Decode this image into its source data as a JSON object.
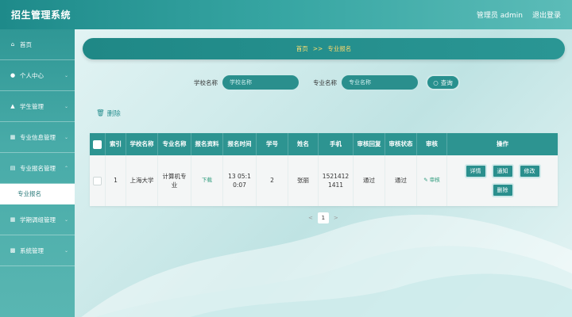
{
  "app": {
    "title": "招生管理系统"
  },
  "topbar": {
    "user": "管理员 admin",
    "logout": "退出登录"
  },
  "sidebar": {
    "items": [
      {
        "label": "首页",
        "icon": "home-icon",
        "glyph": "⌂"
      },
      {
        "label": "个人中心",
        "icon": "user-icon",
        "glyph": "●"
      },
      {
        "label": "学生管理",
        "icon": "graduation-icon",
        "glyph": "▲"
      },
      {
        "label": "专业信息管理",
        "icon": "grid-icon",
        "glyph": "▦"
      },
      {
        "label": "专业报名管理",
        "icon": "document-icon",
        "glyph": "▤"
      },
      {
        "label": "学期调组管理",
        "icon": "grid-icon",
        "glyph": "▦"
      },
      {
        "label": "系统管理",
        "icon": "settings-icon",
        "glyph": "▩"
      }
    ],
    "submenu_label": "专业报名"
  },
  "breadcrumb": {
    "home": "首页",
    "separator": ">>",
    "current": "专业报名"
  },
  "search": {
    "school_label": "学校名称",
    "school_placeholder": "学校名称",
    "major_label": "专业名称",
    "major_placeholder": "专业名称",
    "button": "查询"
  },
  "actions": {
    "delete": "删除"
  },
  "table": {
    "headers": [
      "索引",
      "学校名称",
      "专业名称",
      "报名资料",
      "报名时间",
      "学号",
      "姓名",
      "手机",
      "审核回复",
      "审核状态",
      "审核",
      "操作"
    ],
    "rows": [
      {
        "index": "1",
        "school": "上海大学",
        "major": "计算机专业",
        "material": "下载",
        "time": "13 05:10:07",
        "student_no": "2",
        "name": "张丽",
        "phone": "15214121411",
        "reply": "通过",
        "status": "通过",
        "review": "审核",
        "ops": [
          "详情",
          "通知",
          "修改",
          "删除"
        ]
      }
    ]
  },
  "pager": {
    "prev": "<",
    "page": "1",
    "next": ">"
  },
  "colors": {
    "primary": "#2d9491",
    "accent": "#ffe070"
  }
}
